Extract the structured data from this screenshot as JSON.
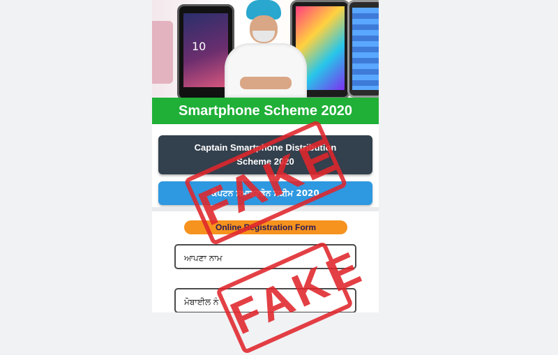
{
  "banner": {
    "phone_clock": "10"
  },
  "header": {
    "title": "Smartphone Scheme 2020"
  },
  "buttons": {
    "dark_label": "Captain Smartphone Distribution Scheme 2020",
    "blue_label": "ਕੈਪਟਨ ਸਮਾਰਟਫੋਨ ਸਕੀਮ 2020"
  },
  "form": {
    "title": "Online Registration Form",
    "name_placeholder": "ਆਪਣਾ ਨਾਮ",
    "mobile_placeholder": "ਮੋਬਾਈਲ ਨੰ"
  },
  "stamps": {
    "top": "FAKE",
    "bottom": "FAKE"
  },
  "colors": {
    "header_green": "#20b038",
    "dark_button": "#33404d",
    "blue_button": "#2e98e0",
    "orange_pill": "#f6921e",
    "stamp_red": "#e0262c"
  }
}
